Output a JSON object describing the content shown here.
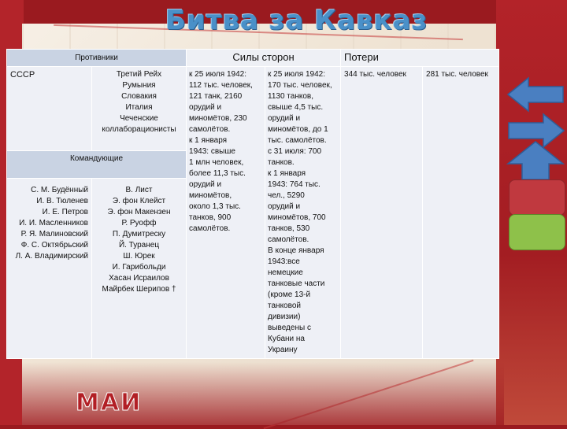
{
  "title": "Битва за Кавказ",
  "watermark": "МАИ",
  "table": {
    "opponents_header": "Противники",
    "forces_header": "Силы сторон",
    "losses_header": "Потери",
    "ussr": "СССР",
    "axis": [
      "Третий Рейх",
      "Румыния",
      "Словакия",
      "Италия",
      "Чеченские",
      "коллаборационисты"
    ],
    "commanders_header": "Командующие",
    "ussr_commanders": [
      "С. М. Будённый",
      "И. В. Тюленев",
      "И. Е. Петров",
      "И. И. Масленников",
      "Р. Я. Малиновский",
      "Ф. С. Октябрьский",
      "Л. А. Владимирский"
    ],
    "axis_commanders": [
      "В. Лист",
      "Э. фон Клейст",
      "Э. фон Макензен",
      "Р. Руофф",
      "П. Думитреску",
      "Й. Туранец",
      "Ш. Юрек",
      "И. Гарибольди",
      "Хасан Исраилов",
      "Майрбек Шерипов †"
    ],
    "ussr_forces": [
      "к 25 июля 1942:",
      "112 тыс. человек,",
      "121 танк, 2160",
      "орудий и",
      "миномётов, 230",
      "самолётов.",
      "к 1 января",
      "1943: свыше",
      "1 млн человек,",
      "более 11,3 тыс.",
      "орудий и",
      "миномётов,",
      "около 1,3 тыс.",
      "танков, 900",
      "самолётов."
    ],
    "axis_forces": [
      "к 25 июля 1942:",
      "170 тыс. человек,",
      "1130 танков,",
      "свыше 4,5 тыс.",
      "орудий и",
      "миномётов, до 1",
      "тыс. самолётов.",
      "с 31 июля: 700",
      "танков.",
      "к 1 января",
      "1943: 764 тыс.",
      "чел., 5290",
      "орудий и",
      "миномётов, 700",
      "танков, 530",
      "самолётов.",
      "В конце января",
      "1943:все",
      "немецкие",
      "танковые части",
      "(кроме 13-й",
      "танковой",
      "дивизии)",
      "выведены с",
      "Кубани на",
      "Украину"
    ],
    "ussr_losses": "344 тыс. человек",
    "axis_losses": "281 тыс. человек"
  },
  "nav": {
    "back_icon": "arrow-left-icon",
    "forward_icon": "arrow-right-icon",
    "up_icon": "arrow-up-icon",
    "red_color": "#c0393f",
    "green_color": "#8ec14a",
    "blue_color": "#4a7fc1"
  }
}
